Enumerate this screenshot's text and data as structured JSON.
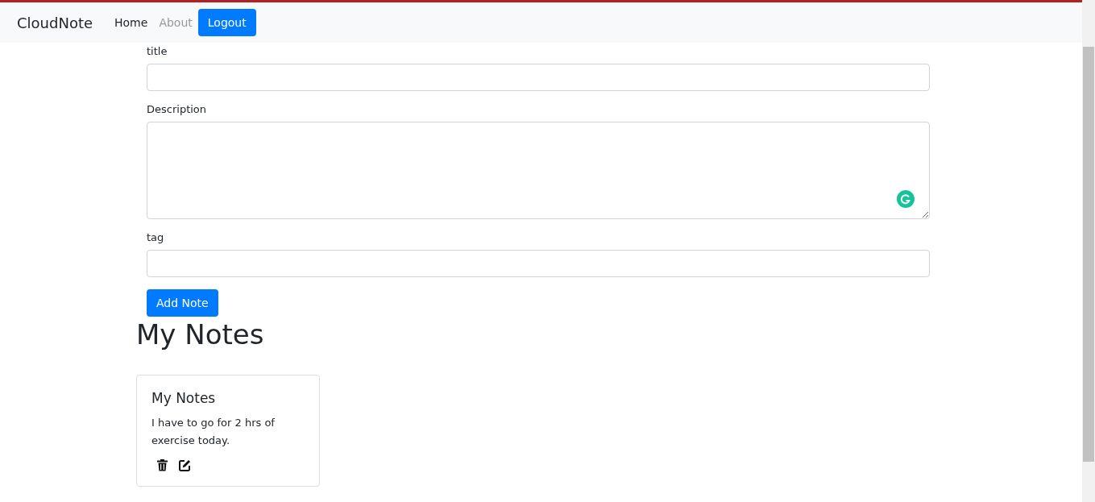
{
  "navbar": {
    "brand": "CloudNote",
    "links": [
      {
        "label": "Home",
        "selected": true
      },
      {
        "label": "About",
        "selected": false
      }
    ],
    "button": "Logout"
  },
  "form": {
    "fields": [
      {
        "label": "title",
        "kind": "input"
      },
      {
        "label": "Description",
        "kind": "textarea"
      },
      {
        "label": "tag",
        "kind": "input"
      }
    ],
    "submit": "Add Note"
  },
  "heading": "My Notes",
  "notes": [
    {
      "title": "My Notes",
      "description": "I have to go for 2 hrs of exercise today."
    }
  ]
}
